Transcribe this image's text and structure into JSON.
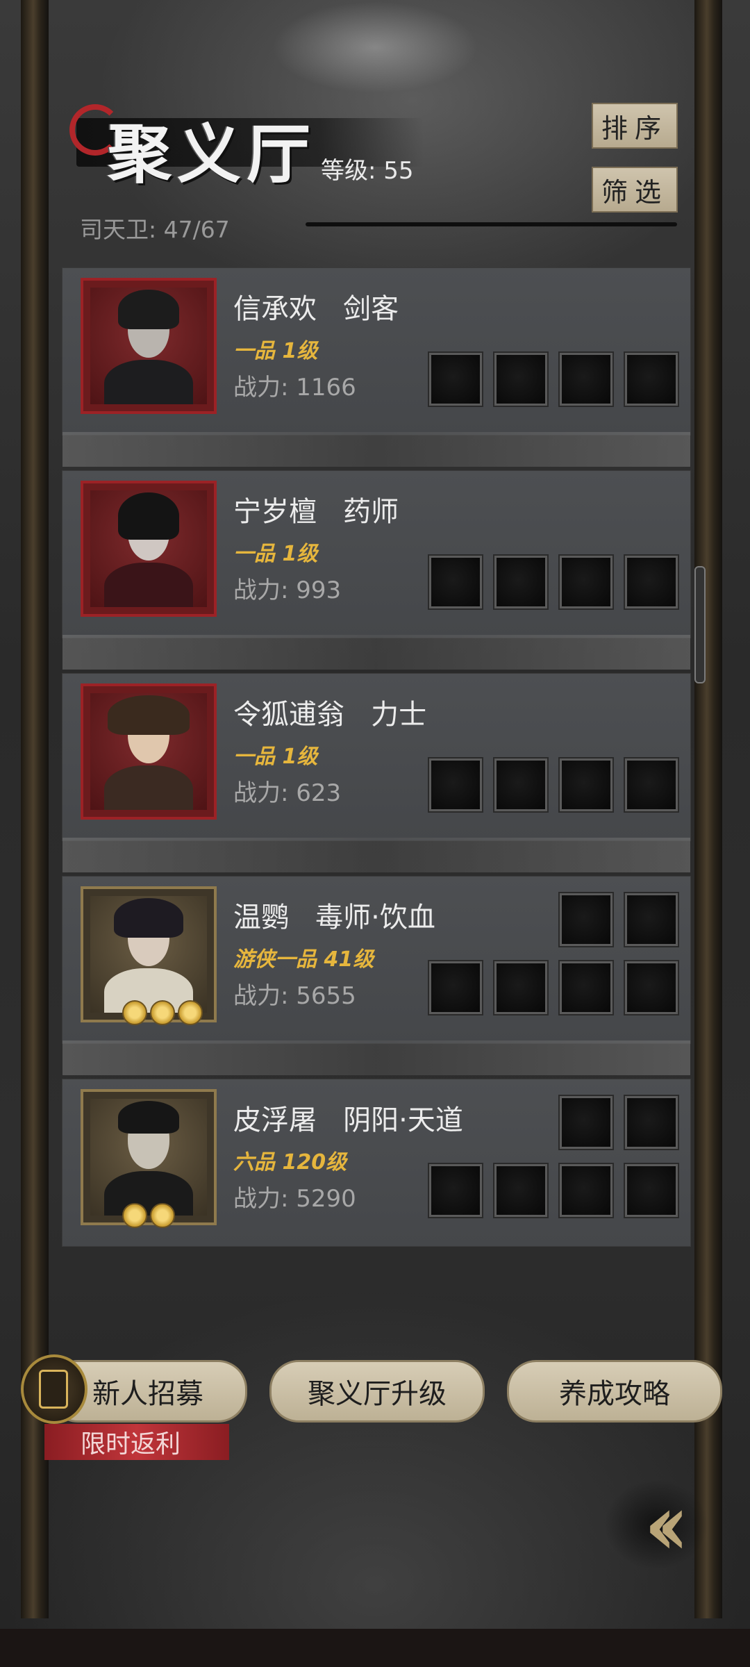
{
  "header": {
    "title": "聚义厅",
    "level_text": "等级: 55",
    "guard_text": "司天卫: 47/67",
    "sort_label": "排序",
    "filter_label": "筛选"
  },
  "members": [
    {
      "name": "信承欢",
      "role": "剑客",
      "grade": "一品",
      "level": "1级",
      "power": "战力: 1166"
    },
    {
      "name": "宁岁檀",
      "role": "药师",
      "grade": "一品",
      "level": "1级",
      "power": "战力: 993"
    },
    {
      "name": "令狐逋翁",
      "role": "力士",
      "grade": "一品",
      "level": "1级",
      "power": "战力: 623"
    },
    {
      "name": "温鹦",
      "role": "毒师·饮血",
      "grade": "游侠一品",
      "level": "41级",
      "power": "战力: 5655"
    },
    {
      "name": "皮浮屠",
      "role": "阴阳·天道",
      "grade": "六品",
      "level": "120级",
      "power": "战力: 5290"
    }
  ],
  "footer": {
    "recruit_label": "新人招募",
    "limited_label": "限时返利",
    "upgrade_label": "聚义厅升级",
    "guide_label": "养成攻略"
  },
  "icons": {
    "back": "double-chevron-left-icon",
    "recruit": "recruit-token-icon"
  },
  "colors": {
    "grade_gold": "#e6b63d",
    "portrait_red": "#9c2226",
    "portrait_gold": "#8f7a4d",
    "button_beige": "#cfc4ad"
  }
}
